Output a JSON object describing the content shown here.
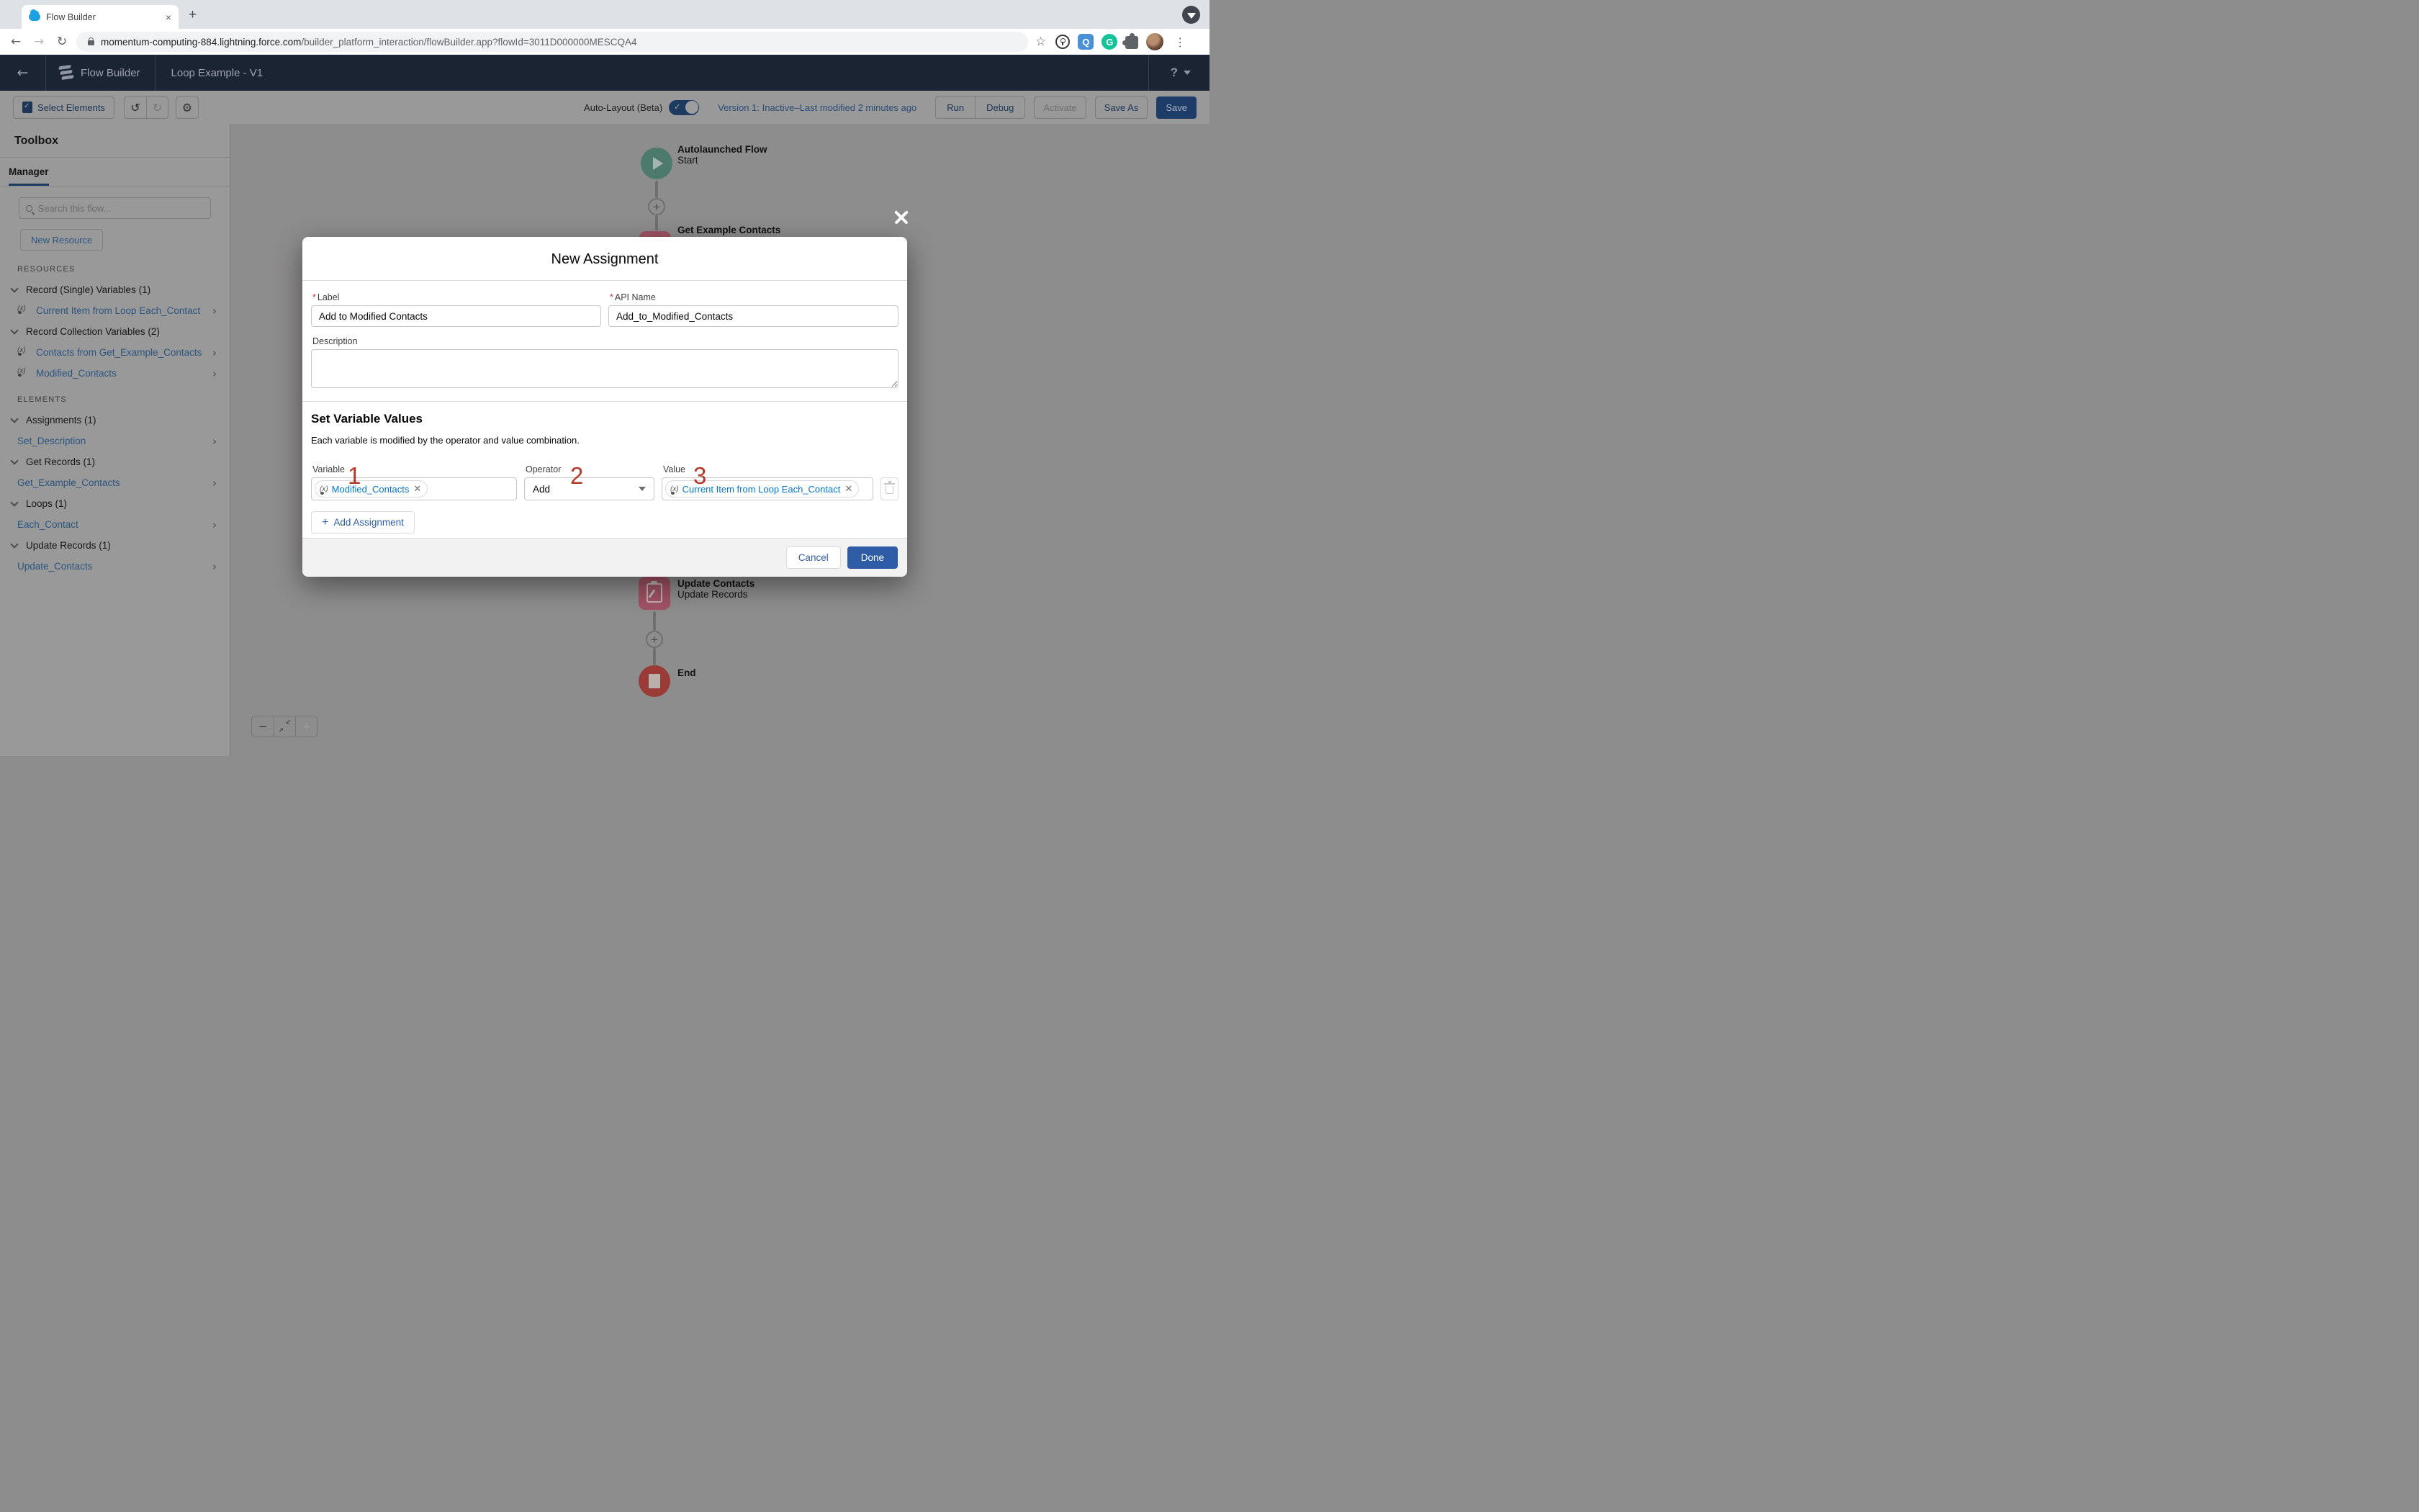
{
  "browser": {
    "tab_title": "Flow Builder",
    "url_domain": "momentum-computing-884.lightning.force.com",
    "url_path": "/builder_platform_interaction/flowBuilder.app?flowId=3011D000000MESCQA4",
    "extensions": [
      "bookmark-star-icon",
      "onepassword-icon",
      "blue-search-extension-icon",
      "grammarly-icon",
      "puzzle-extensions-icon",
      "profile-avatar",
      "kebab-menu-icon"
    ],
    "grammarly_letter": "G",
    "new_tab_glyph": "+",
    "close_tab_glyph": "×"
  },
  "header": {
    "app_name": "Flow Builder",
    "flow_title": "Loop Example - V1",
    "help_label": "?"
  },
  "toolbar": {
    "select_elements_label": "Select Elements",
    "undo_glyph": "↺",
    "redo_glyph": "↻",
    "gear_glyph": "⚙",
    "auto_layout_label": "Auto-Layout (Beta)",
    "toggle_check": "✓",
    "version_status": "Version 1: Inactive–Last modified 2 minutes ago",
    "run_label": "Run",
    "debug_label": "Debug",
    "activate_label": "Activate",
    "save_as_label": "Save As",
    "save_label": "Save"
  },
  "toolbox": {
    "title": "Toolbox",
    "tab_label": "Manager",
    "search_placeholder": "Search this flow...",
    "new_resource_label": "New Resource",
    "resources_heading": "RESOURCES",
    "elements_heading": "ELEMENTS",
    "resources": [
      {
        "group": "Record (Single) Variables (1)",
        "items": [
          "Current Item from Loop Each_Contact"
        ]
      },
      {
        "group": "Record Collection Variables (2)",
        "items": [
          "Contacts from Get_Example_Contacts",
          "Modified_Contacts"
        ]
      }
    ],
    "elements": [
      {
        "group": "Assignments (1)",
        "items": [
          "Set_Description"
        ]
      },
      {
        "group": "Get Records (1)",
        "items": [
          "Get_Example_Contacts"
        ]
      },
      {
        "group": "Loops (1)",
        "items": [
          "Each_Contact"
        ]
      },
      {
        "group": "Update Records (1)",
        "items": [
          "Update_Contacts"
        ]
      }
    ]
  },
  "canvas": {
    "start_title": "Autolaunched Flow",
    "start_subtitle": "Start",
    "get_records_title": "Get Example Contacts",
    "update_title": "Update Contacts",
    "update_subtitle": "Update Records",
    "end_title": "End",
    "zoom_out_glyph": "−",
    "zoom_in_glyph": "+"
  },
  "modal": {
    "title": "New Assignment",
    "label_field": {
      "label": "Label",
      "value": "Add to Modified Contacts"
    },
    "api_field": {
      "label": "API Name",
      "value": "Add_to_Modified_Contacts"
    },
    "description_field": {
      "label": "Description",
      "value": ""
    },
    "section_heading": "Set Variable Values",
    "section_help": "Each variable is modified by the operator and value combination.",
    "variable_label": "Variable",
    "variable_pill": "Modified_Contacts",
    "operator_label": "Operator",
    "operator_value": "Add",
    "value_label": "Value",
    "value_pill": "Current Item from Loop Each_Contact",
    "pill_icon": "(x)",
    "remove_glyph": "✕",
    "annotations": {
      "variable": "1",
      "operator": "2",
      "value": "3"
    },
    "add_assignment_label": "Add Assignment",
    "cancel_label": "Cancel",
    "done_label": "Done"
  },
  "colors": {
    "brand_button_blue": "#2e5ca6",
    "link_blue": "#0176d3",
    "annotation_red": "#b3382c",
    "required_red": "#c23934",
    "start_node_teal": "#4c7b6e",
    "data_node_pink": "#a15364",
    "end_node_red": "#9a3b38",
    "header_navy": "#1b2433"
  }
}
